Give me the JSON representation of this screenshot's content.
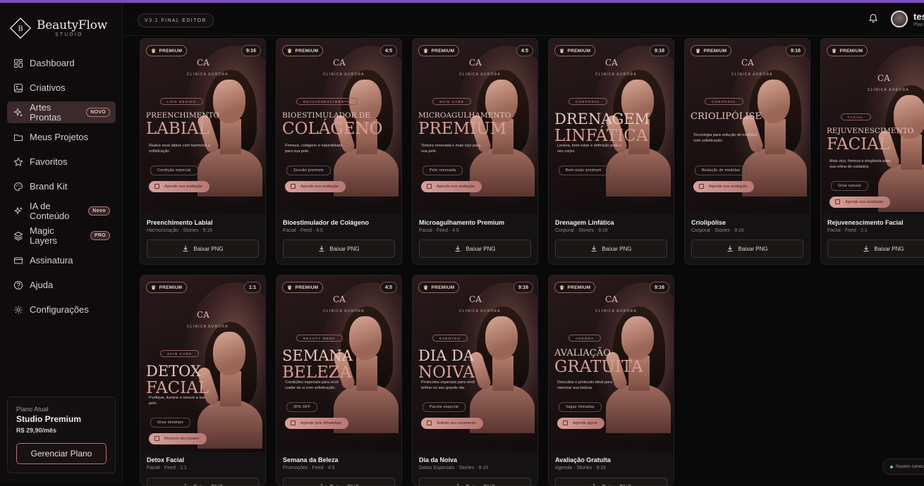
{
  "brand": {
    "name": "BeautyFlow",
    "sub": "STUDIO",
    "logo_letter": "B"
  },
  "nav": [
    {
      "label": "Dashboard",
      "icon": "dashboard-icon"
    },
    {
      "label": "Criativos",
      "icon": "image-icon"
    },
    {
      "label": "Artes Prontas",
      "icon": "sparkles-icon",
      "badge": "NOVO",
      "active": true
    },
    {
      "label": "Meus Projetos",
      "icon": "folder-icon"
    },
    {
      "label": "Favoritos",
      "icon": "star-icon"
    },
    {
      "label": "Brand Kit",
      "icon": "palette-icon"
    },
    {
      "label": "IA de Conteúdo",
      "icon": "ai-sparkle-icon",
      "badge": "Novo"
    },
    {
      "label": "Magic Layers",
      "icon": "layers-icon",
      "badge": "PRO"
    },
    {
      "label": "Assinatura",
      "icon": "card-icon"
    },
    {
      "label": "Ajuda",
      "icon": "help-icon"
    },
    {
      "label": "Configurações",
      "icon": "gear-icon"
    }
  ],
  "plan": {
    "label": "Plano Atual",
    "name": "Studio Premium",
    "price": "R$ 29,90/mês",
    "button": "Gerenciar Plano"
  },
  "topbar": {
    "version": "V3.1 FINAL EDITOR",
    "user_name": "tes",
    "user_plan": "Plan"
  },
  "common": {
    "premium": "PREMIUM",
    "download": "Baixar PNG",
    "clinic": "CLÍNICA AURORA",
    "monogram": "CA"
  },
  "cards": [
    {
      "ratio": "9:16",
      "title": "Preenchimento Labial",
      "sub": "Harmonização · Stories · 9:16",
      "art": {
        "category": "LIPS DESIGN",
        "line1": "PREENCHIMENTO",
        "line2": "LABIAL",
        "text": "Realce seus lábios com harmonia e sofisticação.",
        "cta": "Agende sua avaliação",
        "extra": "Condição especial"
      }
    },
    {
      "ratio": "4:5",
      "title": "Bioestimulador de Colágeno",
      "sub": "Facial · Feed · 4:5",
      "art": {
        "category": "REJUVENESCIMENTO",
        "line1": "BIOESTIMULADOR DE",
        "line2": "COLÁGENO",
        "text": "Firmeza, colágeno e naturalidade para sua pele.",
        "cta": "Agende sua avaliação",
        "extra": "Sessão premium"
      }
    },
    {
      "ratio": "4:5",
      "title": "Microagulhamento Premium",
      "sub": "Facial · Feed · 4:5",
      "art": {
        "category": "SKIN CARE",
        "line1": "MICROAGULHAMENTO",
        "line2": "PREMIUM",
        "text": "Textura renovada e mais viço para sua pele.",
        "cta": "Agende sua avaliação",
        "extra": "Pele renovada"
      }
    },
    {
      "ratio": "9:16",
      "title": "Drenagem Linfática",
      "sub": "Corporal · Stories · 9:16",
      "art": {
        "category": "CORPORAL",
        "line1": "DRENAGEM",
        "line2": "LINFÁTICA",
        "text": "Leveza, bem-estar e definição para o seu corpo.",
        "cta": "",
        "extra": "Bem-estar premium"
      }
    },
    {
      "ratio": "9:16",
      "title": "Criolipólise",
      "sub": "Corporal · Stories · 9:16",
      "art": {
        "category": "CORPORAL",
        "line1": "CRIOLIPÓLISE",
        "line2": "",
        "text": "Tecnologia para redução de medidas com sofisticação.",
        "cta": "Agende sua avaliação",
        "extra": "Redução de medidas"
      }
    },
    {
      "ratio": "1:1",
      "title": "Rejuvenescimento Facial",
      "sub": "Facial · Feed · 1:1",
      "art": {
        "category": "FACIAL",
        "line1": "REJUVENESCIMENTO",
        "line2": "FACIAL",
        "text": "Mais viço, firmeza e elegância para sua rotina de cuidados.",
        "cta": "Agende sua avaliação",
        "extra": "Glow natural"
      }
    },
    {
      "ratio": "1:1",
      "title": "Detox Facial",
      "sub": "Facial · Feed · 1:1",
      "art": {
        "category": "SKIN CARE",
        "line1": "DETOX",
        "line2": "FACIAL",
        "text": "Purifique, ilumine e renove a sua pele.",
        "cta": "Reserve seu horário",
        "extra": "Glow imediato"
      }
    },
    {
      "ratio": "4:5",
      "title": "Semana da Beleza",
      "sub": "Promoções · Feed · 4:5",
      "art": {
        "category": "BEAUTY WEEK",
        "line1": "SEMANA",
        "line2": "BELEZA",
        "text": "Condições especiais para você cuidar de si com sofisticação.",
        "cta": "Agende pelo WhatsApp",
        "extra": "30% OFF"
      }
    },
    {
      "ratio": "9:16",
      "title": "Dia da Noiva",
      "sub": "Datas Especiais · Stories · 9:16",
      "art": {
        "category": "EVENTOS",
        "line1": "DIA DA",
        "line2": "NOIVA",
        "text": "Protocolos especiais para você brilhar no seu grande dia.",
        "cta": "Solicite seu orçamento",
        "extra": "Pacote especial"
      }
    },
    {
      "ratio": "9:16",
      "title": "Avaliação Gratuita",
      "sub": "Agenda · Stories · 9:16",
      "art": {
        "category": "AGENDA",
        "line1": "AVALIAÇÃO",
        "line2": "GRATUITA",
        "text": "Descubra o protocolo ideal para valorizar sua beleza.",
        "cta": "Agende agora",
        "extra": "Vagas limitadas"
      }
    }
  ],
  "toast": "Nuvem conec"
}
